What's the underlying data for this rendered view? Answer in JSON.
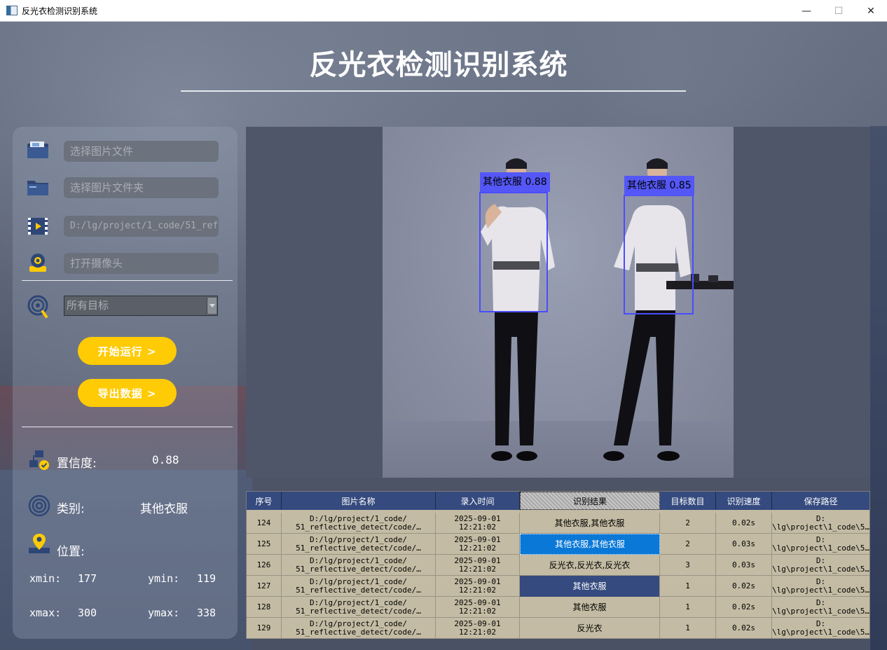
{
  "window": {
    "title": "反光衣检测识别系统",
    "minimize": "—",
    "maximize": "☐",
    "close": "✕"
  },
  "header": {
    "title": "反光衣检测识别系统"
  },
  "inputs": {
    "image_file": "选择图片文件",
    "image_folder": "选择图片文件夹",
    "video_path": "D:/lg/project/1_code/51_ref",
    "camera": "打开摄像头"
  },
  "target_select": {
    "value": "所有目标"
  },
  "buttons": {
    "start": "开始运行 >",
    "export": "导出数据 >"
  },
  "result_info": {
    "confidence_label": "置信度:",
    "confidence_value": "0.88",
    "class_label": "类别:",
    "class_value": "其他衣服",
    "position_label": "位置:",
    "xmin_label": "xmin:",
    "xmin": "177",
    "ymin_label": "ymin:",
    "ymin": "119",
    "xmax_label": "xmax:",
    "xmax": "300",
    "ymax_label": "ymax:",
    "ymax": "338"
  },
  "detections": [
    {
      "label": "其他衣服 0.88"
    },
    {
      "label": "其他衣服 0.85"
    }
  ],
  "table": {
    "columns": [
      "序号",
      "图片名称",
      "录入时间",
      "识别结果",
      "目标数目",
      "识别速度",
      "保存路径"
    ],
    "rows": [
      {
        "id": "124",
        "name1": "D:/lg/project/1_code/",
        "name2": "51_reflective_detect/code/…",
        "date": "2025-09-01",
        "time": "12:21:02",
        "result": "其他衣服,其他衣服",
        "count": "2",
        "speed": "0.02s",
        "path1": "D:",
        "path2": "\\lg\\project\\1_code\\5…"
      },
      {
        "id": "125",
        "name1": "D:/lg/project/1_code/",
        "name2": "51_reflective_detect/code/…",
        "date": "2025-09-01",
        "time": "12:21:02",
        "result": "其他衣服,其他衣服",
        "count": "2",
        "speed": "0.03s",
        "path1": "D:",
        "path2": "\\lg\\project\\1_code\\5…"
      },
      {
        "id": "126",
        "name1": "D:/lg/project/1_code/",
        "name2": "51_reflective_detect/code/…",
        "date": "2025-09-01",
        "time": "12:21:02",
        "result": "反光衣,反光衣,反光衣",
        "count": "3",
        "speed": "0.03s",
        "path1": "D:",
        "path2": "\\lg\\project\\1_code\\5…"
      },
      {
        "id": "127",
        "name1": "D:/lg/project/1_code/",
        "name2": "51_reflective_detect/code/…",
        "date": "2025-09-01",
        "time": "12:21:02",
        "result": "其他衣服",
        "count": "1",
        "speed": "0.02s",
        "path1": "D:",
        "path2": "\\lg\\project\\1_code\\5…"
      },
      {
        "id": "128",
        "name1": "D:/lg/project/1_code/",
        "name2": "51_reflective_detect/code/…",
        "date": "2025-09-01",
        "time": "12:21:02",
        "result": "其他衣服",
        "count": "1",
        "speed": "0.02s",
        "path1": "D:",
        "path2": "\\lg\\project\\1_code\\5…"
      },
      {
        "id": "129",
        "name1": "D:/lg/project/1_code/",
        "name2": "51_reflective_detect/code/…",
        "date": "2025-09-01",
        "time": "12:21:02",
        "result": "反光衣",
        "count": "1",
        "speed": "0.02s",
        "path1": "D:",
        "path2": "\\lg\\project\\1_code\\5…"
      }
    ]
  },
  "colors": {
    "accent": "#ffcb05",
    "table_header": "#354a7e",
    "selected_cell": "#0a78d7",
    "box": "#4a4cff"
  }
}
